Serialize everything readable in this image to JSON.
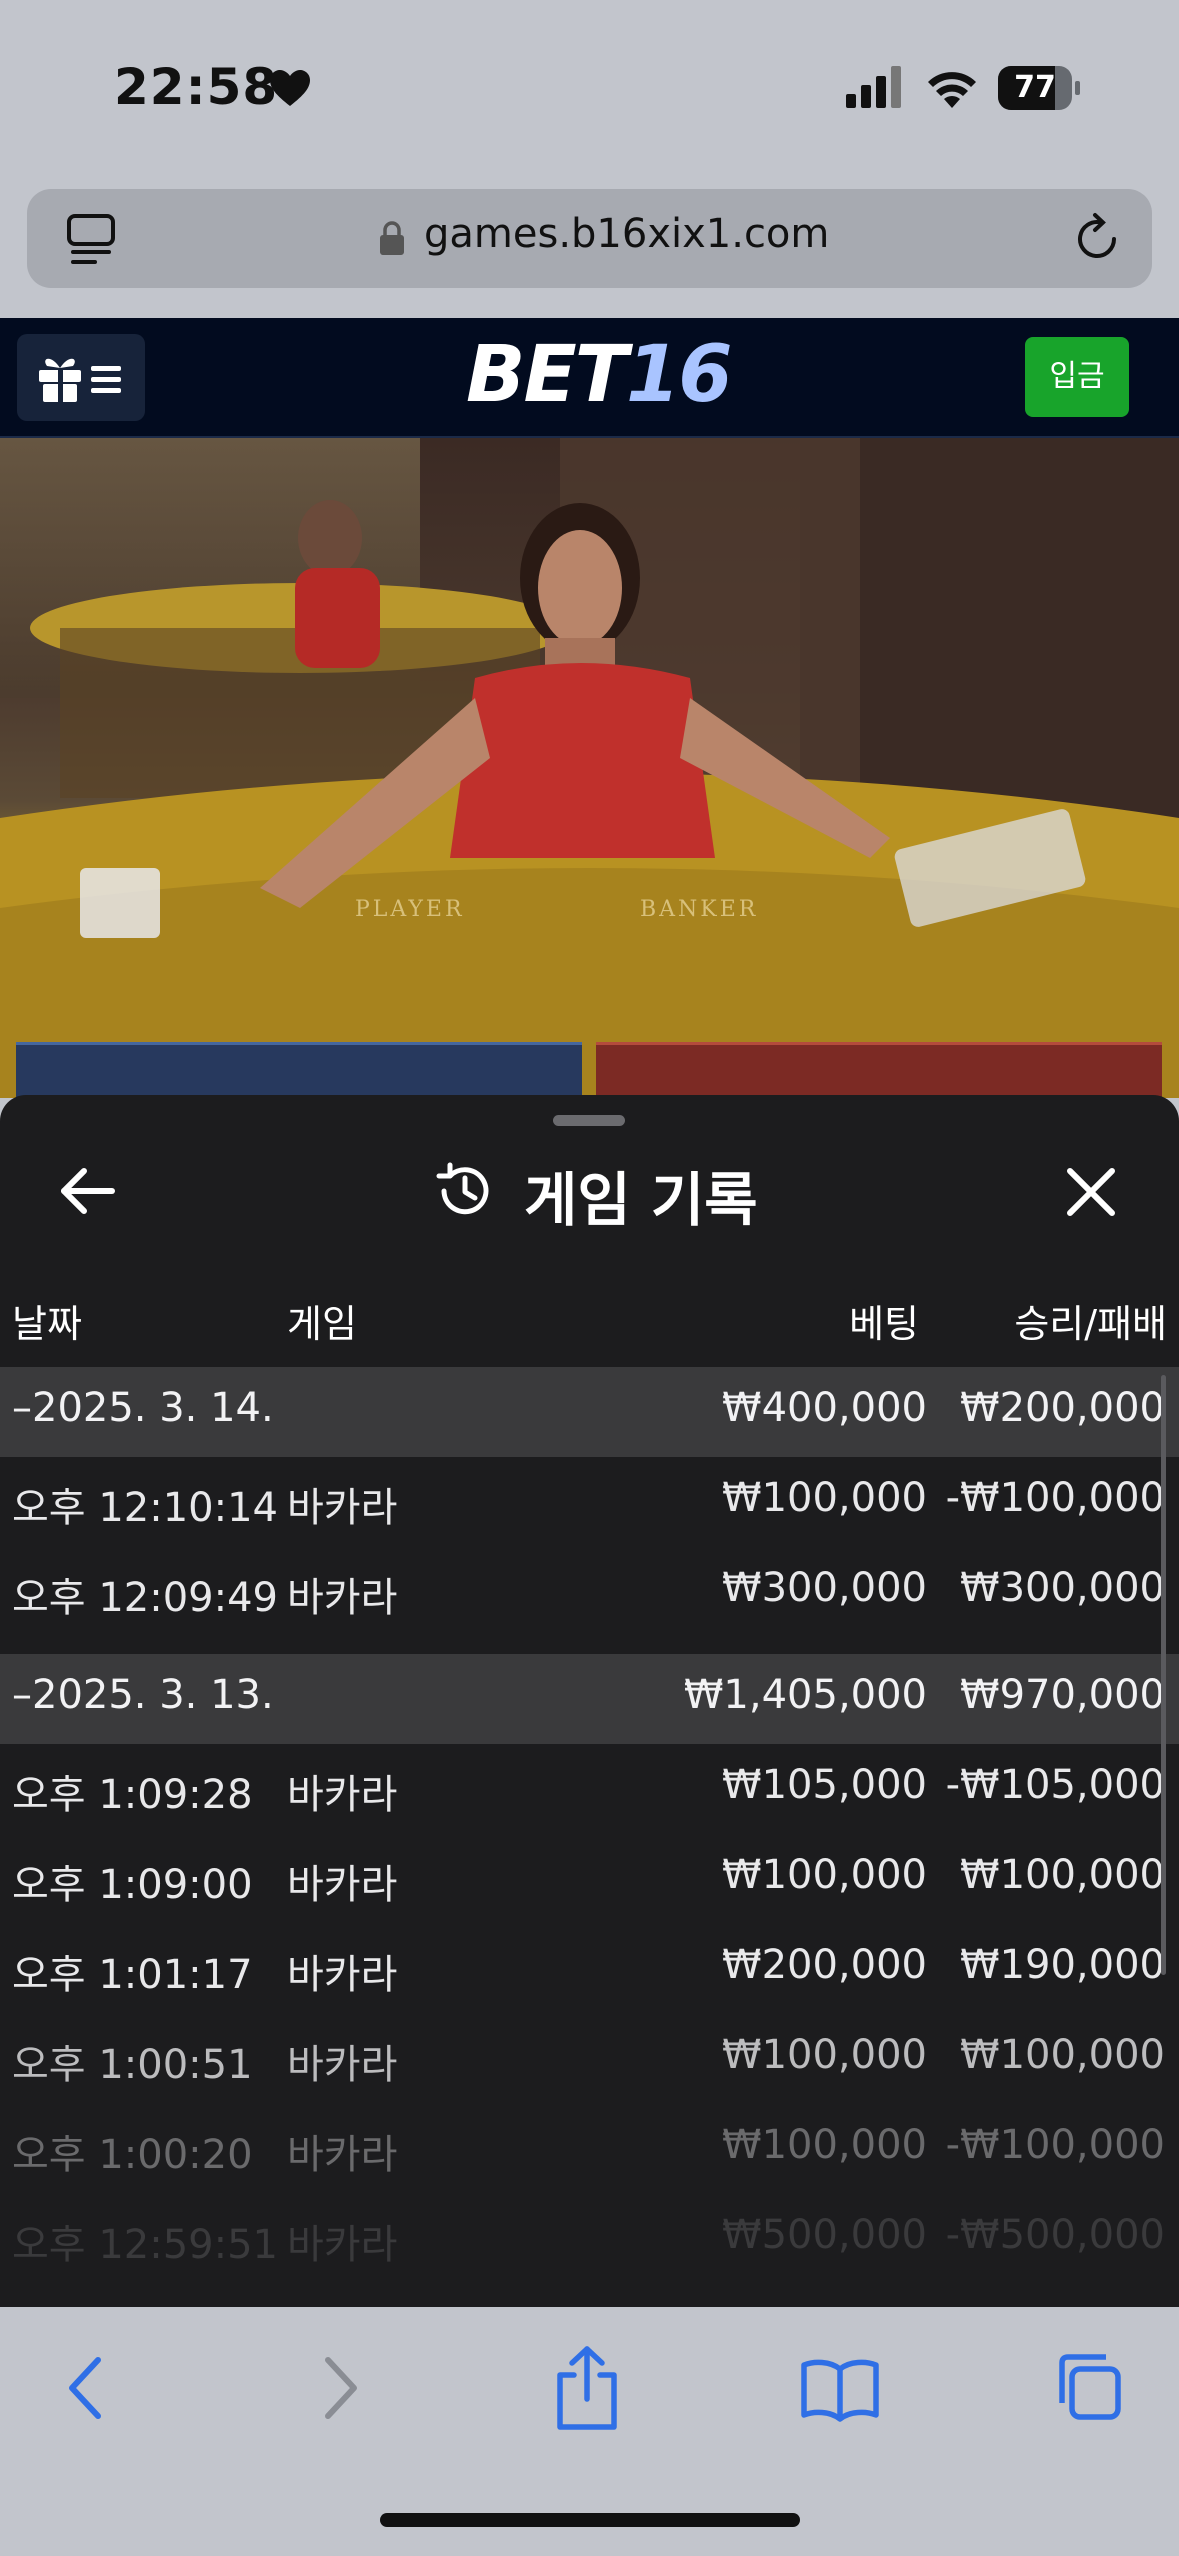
{
  "status": {
    "time": "22:58",
    "battery": "77",
    "battery_level": 0.77,
    "icons": [
      "heart-icon",
      "cellular-signal-icon",
      "wifi-icon",
      "battery-icon"
    ]
  },
  "browser": {
    "url": "games.b16xix1.com",
    "icons": [
      "tabs-icon",
      "lock-icon",
      "reload-icon",
      "back-icon",
      "forward-icon",
      "share-icon",
      "bookmarks-icon",
      "tab-overview-icon"
    ]
  },
  "site": {
    "logo_part1": "BET",
    "logo_part2": "16",
    "deposit_label": "입금",
    "menu_icons": [
      "gift-icon",
      "menu-icon"
    ]
  },
  "history": {
    "title": "게임 기록",
    "columns": {
      "date": "날짜",
      "game": "게임",
      "bet": "베팅",
      "win": "승리/패배"
    },
    "groups": [
      {
        "date": "–2025. 3. 14.",
        "bet": "₩400,000",
        "win": "₩200,000",
        "rows": [
          {
            "time": "오후 12:10:14",
            "game": "바카라",
            "bet": "₩100,000",
            "win": "-₩100,000"
          },
          {
            "time": "오후 12:09:49",
            "game": "바카라",
            "bet": "₩300,000",
            "win": "₩300,000"
          }
        ]
      },
      {
        "date": "–2025. 3. 13.",
        "bet": "₩1,405,000",
        "win": "₩970,000",
        "rows": [
          {
            "time": "오후 1:09:28",
            "game": "바카라",
            "bet": "₩105,000",
            "win": "-₩105,000"
          },
          {
            "time": "오후 1:09:00",
            "game": "바카라",
            "bet": "₩100,000",
            "win": "₩100,000"
          },
          {
            "time": "오후 1:01:17",
            "game": "바카라",
            "bet": "₩200,000",
            "win": "₩190,000"
          },
          {
            "time": "오후 1:00:51",
            "game": "바카라",
            "bet": "₩100,000",
            "win": "₩100,000"
          },
          {
            "time": "오후 1:00:20",
            "game": "바카라",
            "bet": "₩100,000",
            "win": "-₩100,000"
          },
          {
            "time": "오후 12:59:51",
            "game": "바카라",
            "bet": "₩500,000",
            "win": "-₩500,000"
          }
        ]
      }
    ]
  },
  "video": {
    "table_labels": [
      "PLAYER",
      "BANKER"
    ]
  }
}
